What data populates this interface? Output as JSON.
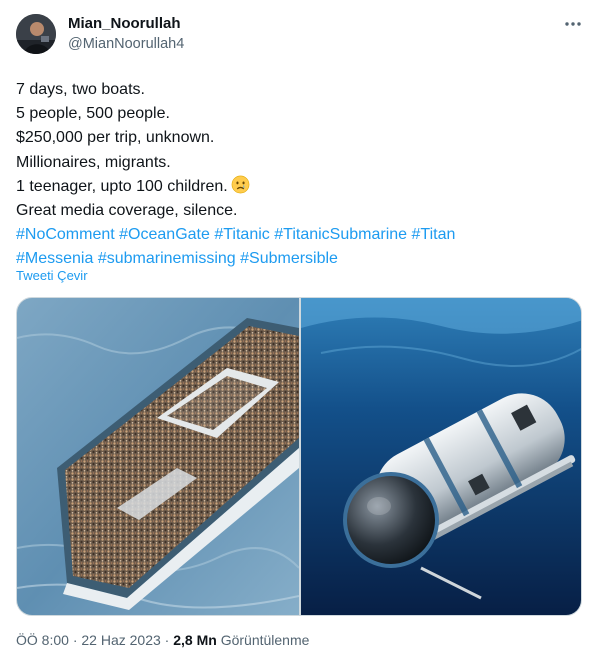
{
  "author": {
    "name": "Mian_Noorullah",
    "handle": "@MianNoorullah4"
  },
  "tweet": {
    "lines": [
      "7 days, two boats.",
      "5 people, 500 people.",
      "$250,000 per trip, unknown.",
      "Millionaires, migrants.",
      "1 teenager, upto 100 children.",
      "Great media coverage, silence."
    ],
    "hashtags_line1": [
      "#NoComment",
      "#OceanGate",
      "#Titanic",
      "#TitanicSubmarine",
      "#Titan"
    ],
    "hashtags_line2": [
      "#Messenia",
      "#submarinemissing",
      "#Submersible"
    ],
    "emoji": "crying-face-emoji",
    "translate_label": "Tweeti Çevir"
  },
  "meta": {
    "time": "ÖÖ 8:00",
    "date": "22 Haz 2023",
    "separator": "·",
    "views_count": "2,8 Mn",
    "views_label": "Görüntülenme"
  },
  "icons": {
    "more": "more-horizontal-icon"
  },
  "colors": {
    "link": "#1d9bf0",
    "text": "#0f1419",
    "secondary": "#536471"
  }
}
